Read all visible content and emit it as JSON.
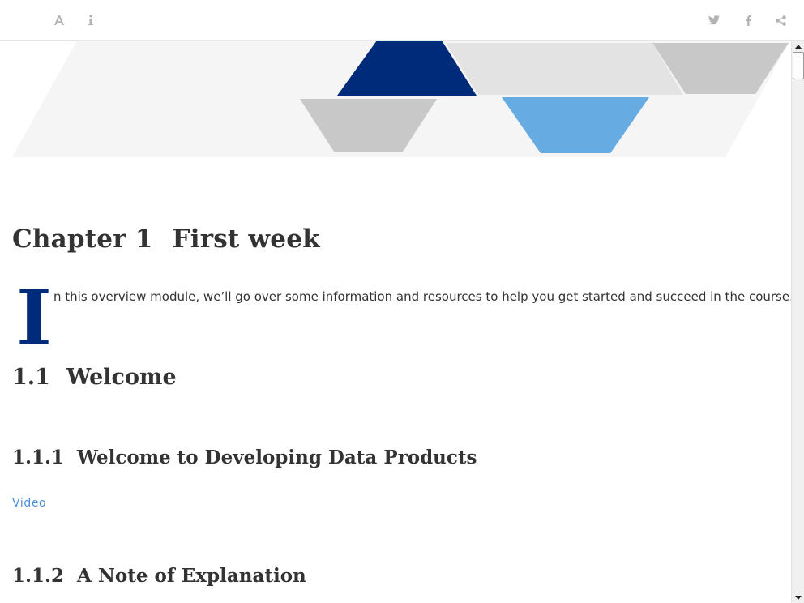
{
  "toolbar": {
    "left_icons": [
      "font-settings-icon",
      "info-icon"
    ],
    "right_icons": [
      "twitter-icon",
      "facebook-icon",
      "share-icon"
    ]
  },
  "banner": {
    "colors": {
      "background": "#f5f5f5",
      "navy": "#002b7a",
      "grey": "#c8c8c8",
      "light_grey": "#e3e3e3",
      "light_blue": "#66abe2"
    }
  },
  "chapter": {
    "number": "Chapter 1",
    "title": "First week",
    "dropcap": "I",
    "intro": "n this overview module, we’ll go over some information and resources to help you get started and succeed in the course."
  },
  "section_1_1": {
    "number": "1.1",
    "title": "Welcome"
  },
  "section_1_1_1": {
    "number": "1.1.1",
    "title": "Welcome to Developing Data Products",
    "link": "Video"
  },
  "section_1_1_2": {
    "number": "1.1.2",
    "title": "A Note of Explanation"
  },
  "colors": {
    "accent_navy": "#002b7a",
    "link_blue": "#4a90d9",
    "text": "#333333"
  }
}
